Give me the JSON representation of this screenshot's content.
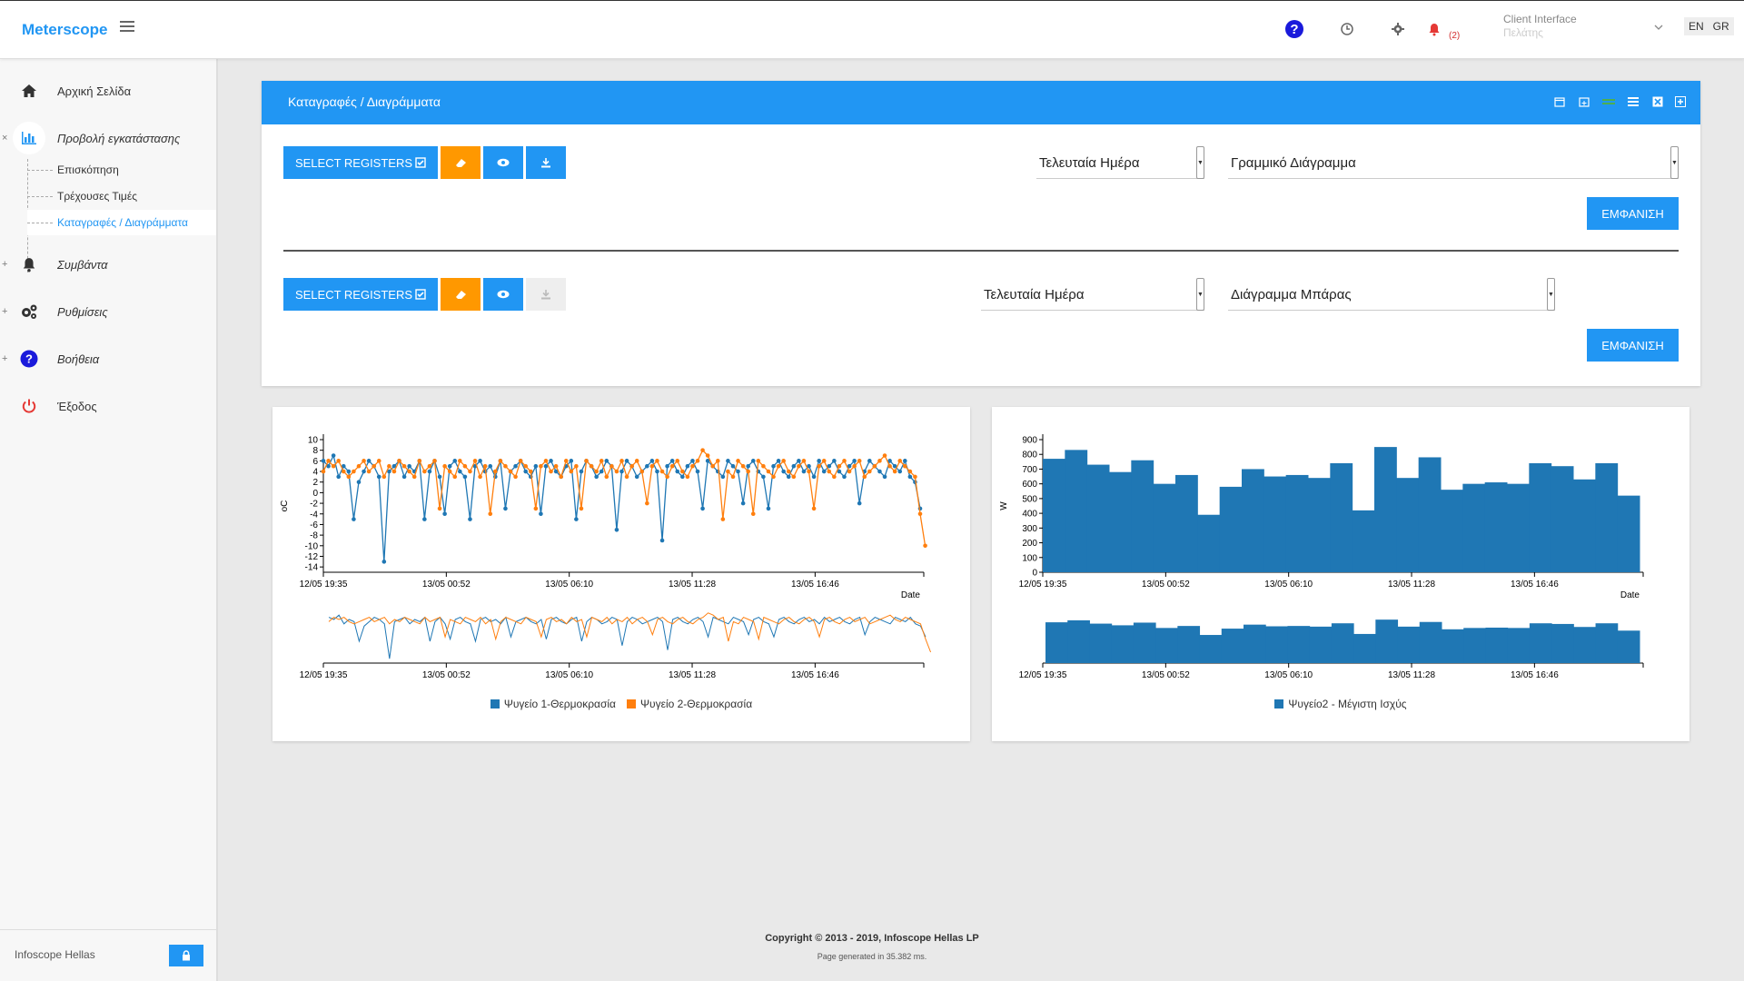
{
  "app": {
    "brand": "Meterscope"
  },
  "topbar": {
    "help_glyph": "?",
    "notifications_count": "(2)",
    "client_label": "Client Interface",
    "client_sub": "Πελάτης",
    "lang_en": "EN",
    "lang_gr": "GR"
  },
  "sidebar": {
    "items": [
      {
        "label": "Αρχική Σελίδα",
        "icon": "home-icon"
      },
      {
        "label": "Προβολή εγκατάστασης",
        "icon": "bar-chart-icon",
        "toggle": "×"
      },
      {
        "label": "Συμβάντα",
        "icon": "bell-icon",
        "toggle": "+"
      },
      {
        "label": "Ρυθμίσεις",
        "icon": "gears-icon",
        "toggle": "+"
      },
      {
        "label": "Βοήθεια",
        "icon": "help-icon",
        "toggle": "+"
      },
      {
        "label": "Έξοδος",
        "icon": "power-icon"
      }
    ],
    "subitems": [
      {
        "label": "Επισκόπηση"
      },
      {
        "label": "Τρέχουσες Τιμές"
      },
      {
        "label": "Καταγραφές / Διαγράμματα"
      }
    ],
    "footer_name": "Infoscope Hellas"
  },
  "panel": {
    "title": "Καταγραφές / Διαγράμματα",
    "row1": {
      "select_registers": "SELECT REGISTERS",
      "period": "Τελευταία Ημέρα",
      "chart_type": "Γραμμικό Διάγραμμα",
      "show": "ΕΜΦΑΝΙΣΗ"
    },
    "row2": {
      "select_registers": "SELECT REGISTERS",
      "period": "Τελευταία Ημέρα",
      "chart_type": "Διάγραμμα Μπάρας",
      "show": "ΕΜΦΑΝΙΣΗ"
    }
  },
  "colors": {
    "accent": "#2196f3",
    "orange": "#ff9800",
    "series_blue": "#1f77b4",
    "series_orange": "#ff7f0e"
  },
  "chart_data": [
    {
      "type": "line",
      "ylabel": "oC",
      "xlabel": "Date",
      "ylim": [
        -15,
        10
      ],
      "y_ticks": [
        10,
        8,
        6,
        4,
        2,
        0,
        -2,
        -4,
        -6,
        -8,
        -10,
        -12,
        -14
      ],
      "x_ticks": [
        "12/05 19:35",
        "13/05 00:52",
        "13/05 06:10",
        "13/05 11:28",
        "13/05 16:46"
      ],
      "legend": "bottom-center",
      "series": [
        {
          "name": "Ψυγείο 1-Θερμοκρασία",
          "color": "#1f77b4",
          "values": [
            6,
            5,
            7,
            3,
            5,
            4,
            -5,
            2,
            4,
            6,
            5,
            3,
            -13,
            4,
            5,
            6,
            3,
            5,
            4,
            6,
            -5,
            4,
            6,
            3,
            -4,
            5,
            6,
            4,
            3,
            -5,
            5,
            6,
            4,
            5,
            3,
            6,
            -3,
            4,
            5,
            6,
            4,
            3,
            5,
            -4,
            5,
            6,
            4,
            3,
            5,
            6,
            -5,
            4,
            6,
            5,
            3,
            4,
            6,
            5,
            -7,
            4,
            6,
            5,
            3,
            4,
            5,
            6,
            4,
            -9,
            5,
            6,
            4,
            3,
            5,
            6,
            4,
            -3,
            6,
            5,
            4,
            3,
            6,
            5,
            4,
            -2,
            5,
            6,
            4,
            3,
            -3,
            5,
            6,
            4,
            3,
            5,
            6,
            4,
            5,
            3,
            6,
            4,
            5,
            6,
            4,
            3,
            5,
            6,
            -2,
            4,
            6,
            5,
            4,
            3,
            6,
            5,
            4,
            6,
            3,
            2,
            -3
          ]
        },
        {
          "name": "Ψυγείο 2-Θερμοκρασία",
          "color": "#ff7f0e",
          "values": [
            4,
            6,
            5,
            6,
            4,
            3,
            4,
            5,
            6,
            4,
            5,
            6,
            3,
            5,
            4,
            6,
            5,
            4,
            3,
            6,
            4,
            5,
            6,
            -3,
            5,
            4,
            3,
            6,
            5,
            4,
            6,
            3,
            5,
            -4,
            4,
            6,
            5,
            4,
            3,
            6,
            5,
            4,
            -3,
            5,
            6,
            4,
            5,
            3,
            6,
            4,
            5,
            -3,
            6,
            5,
            4,
            6,
            3,
            5,
            4,
            6,
            3,
            5,
            6,
            4,
            -2,
            5,
            6,
            4,
            3,
            5,
            6,
            4,
            3,
            5,
            6,
            8,
            7,
            5,
            6,
            -5,
            4,
            3,
            6,
            5,
            4,
            -4,
            6,
            5,
            4,
            3,
            5,
            6,
            4,
            3,
            5,
            6,
            4,
            -3,
            5,
            6,
            4,
            3,
            5,
            6,
            4,
            5,
            6,
            3,
            4,
            5,
            6,
            7,
            5,
            4,
            6,
            5,
            4,
            3,
            -4,
            -10
          ]
        }
      ]
    },
    {
      "type": "bar",
      "ylabel": "W",
      "xlabel": "Date",
      "ylim": [
        0,
        900
      ],
      "y_ticks": [
        900,
        800,
        700,
        600,
        500,
        400,
        300,
        200,
        100,
        0
      ],
      "x_ticks": [
        "12/05 19:35",
        "13/05 00:52",
        "13/05 06:10",
        "13/05 11:28",
        "13/05 16:46"
      ],
      "legend": "bottom-center",
      "series": [
        {
          "name": "Ψυγείο2 - Μέγιστη Ισχύς",
          "color": "#1f77b4",
          "values": [
            770,
            830,
            730,
            680,
            760,
            600,
            660,
            390,
            580,
            700,
            650,
            660,
            640,
            740,
            420,
            850,
            640,
            780,
            560,
            600,
            610,
            600,
            740,
            720,
            630,
            740,
            520
          ]
        }
      ]
    }
  ],
  "footer": {
    "copyright": "Copyright © 2013 - 2019, Infoscope Hellas LP",
    "page_generated": "Page generated in 35.382 ms."
  }
}
